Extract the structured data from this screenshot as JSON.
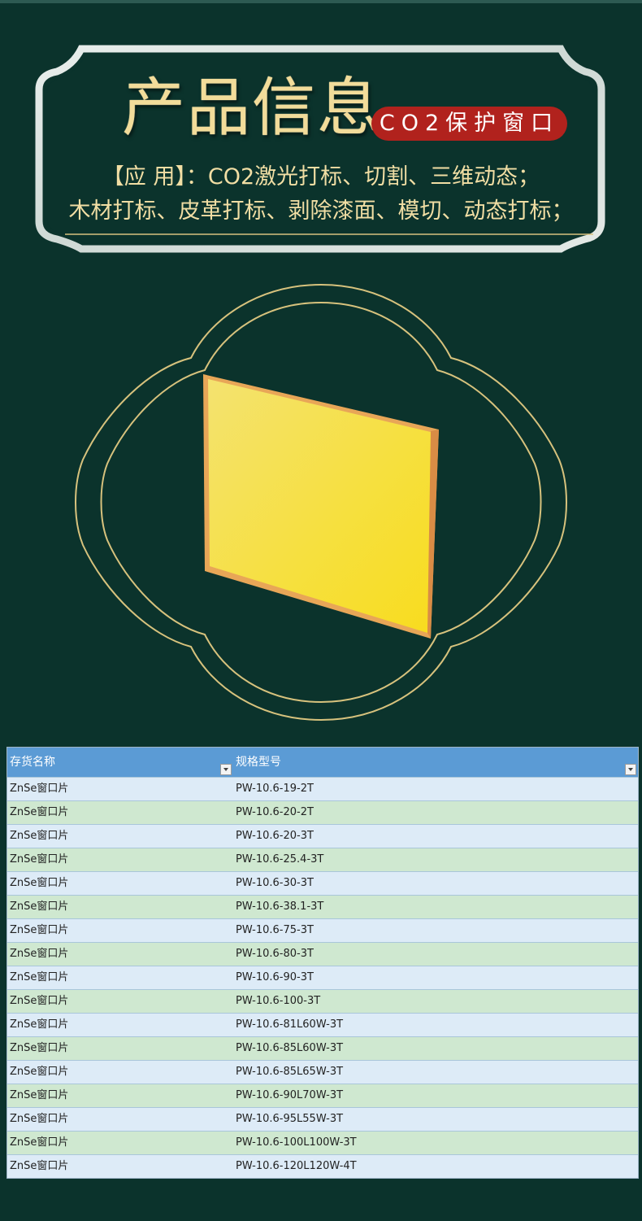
{
  "header": {
    "title": "产品信息",
    "badge": "CO2保护窗口",
    "application_line1": "【应 用】：CO2激光打标、切割、三维动态；",
    "application_line2": "木材打标、皮革打标、剥除漆面、模切、动态打标；"
  },
  "colors": {
    "background": "#0b332c",
    "gold": "#f1dea4",
    "badge_red": "#b1221d",
    "table_header": "#5b9bd5",
    "row_blue": "#ddebf7",
    "row_green": "#cfe8d0",
    "product_yellow": "#f5dc3a"
  },
  "table": {
    "columns": [
      "存货名称",
      "规格型号"
    ],
    "rows": [
      [
        "ZnSe窗口片",
        "PW-10.6-19-2T"
      ],
      [
        "ZnSe窗口片",
        "PW-10.6-20-2T"
      ],
      [
        "ZnSe窗口片",
        "PW-10.6-20-3T"
      ],
      [
        "ZnSe窗口片",
        "PW-10.6-25.4-3T"
      ],
      [
        "ZnSe窗口片",
        "PW-10.6-30-3T"
      ],
      [
        "ZnSe窗口片",
        "PW-10.6-38.1-3T"
      ],
      [
        "ZnSe窗口片",
        "PW-10.6-75-3T"
      ],
      [
        "ZnSe窗口片",
        "PW-10.6-80-3T"
      ],
      [
        "ZnSe窗口片",
        "PW-10.6-90-3T"
      ],
      [
        "ZnSe窗口片",
        "PW-10.6-100-3T"
      ],
      [
        "ZnSe窗口片",
        "PW-10.6-81L60W-3T"
      ],
      [
        "ZnSe窗口片",
        "PW-10.6-85L60W-3T"
      ],
      [
        "ZnSe窗口片",
        "PW-10.6-85L65W-3T"
      ],
      [
        "ZnSe窗口片",
        "PW-10.6-90L70W-3T"
      ],
      [
        "ZnSe窗口片",
        "PW-10.6-95L55W-3T"
      ],
      [
        "ZnSe窗口片",
        "PW-10.6-100L100W-3T"
      ],
      [
        "ZnSe窗口片",
        "PW-10.6-120L120W-4T"
      ]
    ]
  }
}
